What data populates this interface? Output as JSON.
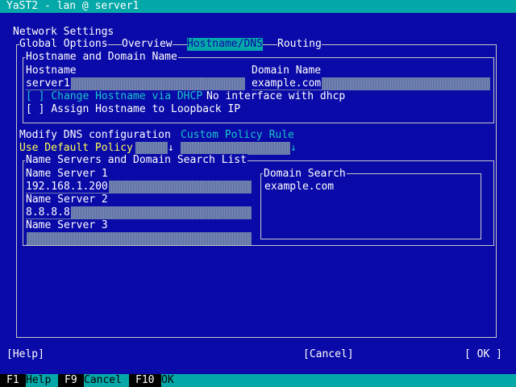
{
  "window": {
    "title": "YaST2 - lan @ server1"
  },
  "page": {
    "title": "Network Settings"
  },
  "tabs": [
    {
      "label": "Global Options"
    },
    {
      "label": "Overview"
    },
    {
      "label": "Hostname/DNS"
    },
    {
      "label": "Routing"
    }
  ],
  "hostname_group": {
    "legend": "Hostname and Domain Name",
    "hostname_label": "Hostname",
    "hostname_value": "server1",
    "domain_label": "Domain Name",
    "domain_value": "example.com",
    "dhcp_checkbox": {
      "mark": "[ ]",
      "label": "Change Hostname via DHCP",
      "state": false
    },
    "dhcp_status": "No interface with dhcp",
    "loopback_checkbox": {
      "mark": "[ ]",
      "label": "Assign Hostname to Loopback IP",
      "state": false
    }
  },
  "dns": {
    "modify_label": "Modify DNS configuration",
    "policy_label": "Custom Policy Rule",
    "modify_value": "Use Default Policy",
    "arrow": "↓",
    "policy_value": ""
  },
  "nameservers_group": {
    "legend": "Name Servers and Domain Search List",
    "servers": [
      {
        "label": "Name Server 1",
        "value": "192.168.1.200"
      },
      {
        "label": "Name Server 2",
        "value": "8.8.8.8"
      },
      {
        "label": "Name Server 3",
        "value": ""
      }
    ],
    "domain_search_legend": "Domain Search",
    "domain_search_items": [
      "example.com"
    ]
  },
  "buttons": {
    "help": "[Help]",
    "cancel": "[Cancel]",
    "ok": "[ OK ]"
  },
  "function_keys": [
    {
      "key": "F1",
      "label": "Help"
    },
    {
      "key": "F9",
      "label": "Cancel"
    },
    {
      "key": "F10",
      "label": "OK"
    }
  ],
  "colors": {
    "background": "#0a0aa8",
    "titlebar": "#05a8a8",
    "accent": "#19c6c6",
    "hotkey": "#ffff55"
  }
}
